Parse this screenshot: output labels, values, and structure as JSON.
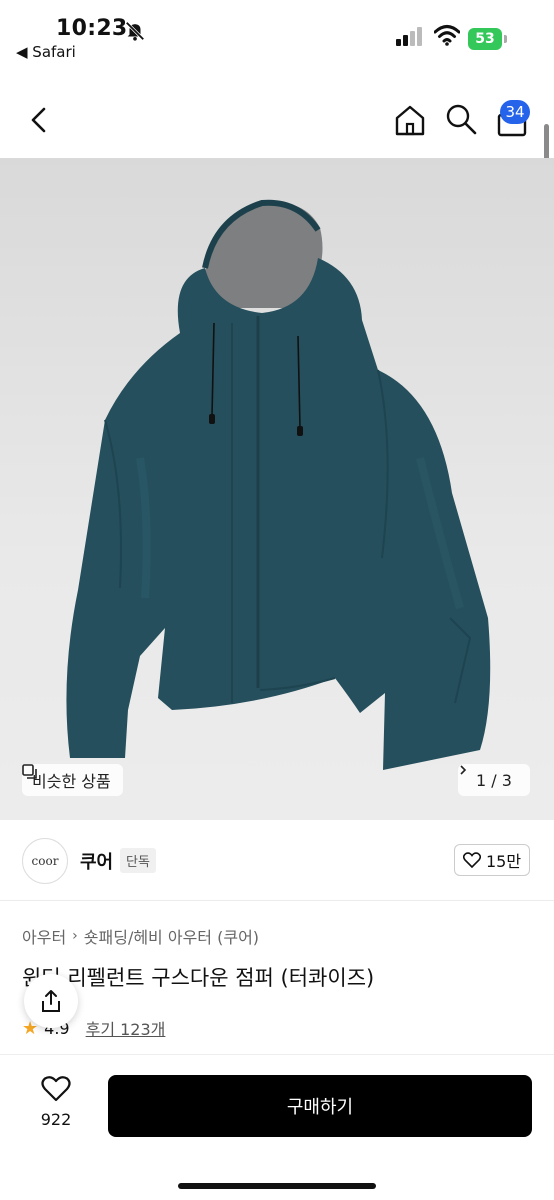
{
  "status_bar": {
    "time": "10:23",
    "back_app": "◀ Safari",
    "battery": "53"
  },
  "nav": {
    "cart_count": "34"
  },
  "gallery": {
    "similar_label": "비슷한 상품",
    "pager": "1 / 3",
    "product_color": "#254f5c",
    "lining_color": "#7d7f81"
  },
  "seller": {
    "logo_text": "coor",
    "name": "쿠어",
    "badge": "단독",
    "likes": "15만"
  },
  "product": {
    "breadcrumb": [
      "아우터",
      "숏패딩/헤비 아우터 (쿠어)"
    ],
    "title": "윈터 리펠런트 구스다운 점퍼 (터콰이즈)",
    "rating": "4.9",
    "reviews": "후기 123개"
  },
  "bottom": {
    "wish_count": "922",
    "buy_label": "구매하기"
  },
  "icons": [
    "bell-slash-icon",
    "signal-icon",
    "wifi-icon",
    "battery-icon",
    "back-chevron-icon",
    "home-icon",
    "search-icon",
    "cart-icon",
    "copy-icon",
    "chevron-right-icon",
    "heart-icon",
    "star-icon",
    "share-icon"
  ]
}
